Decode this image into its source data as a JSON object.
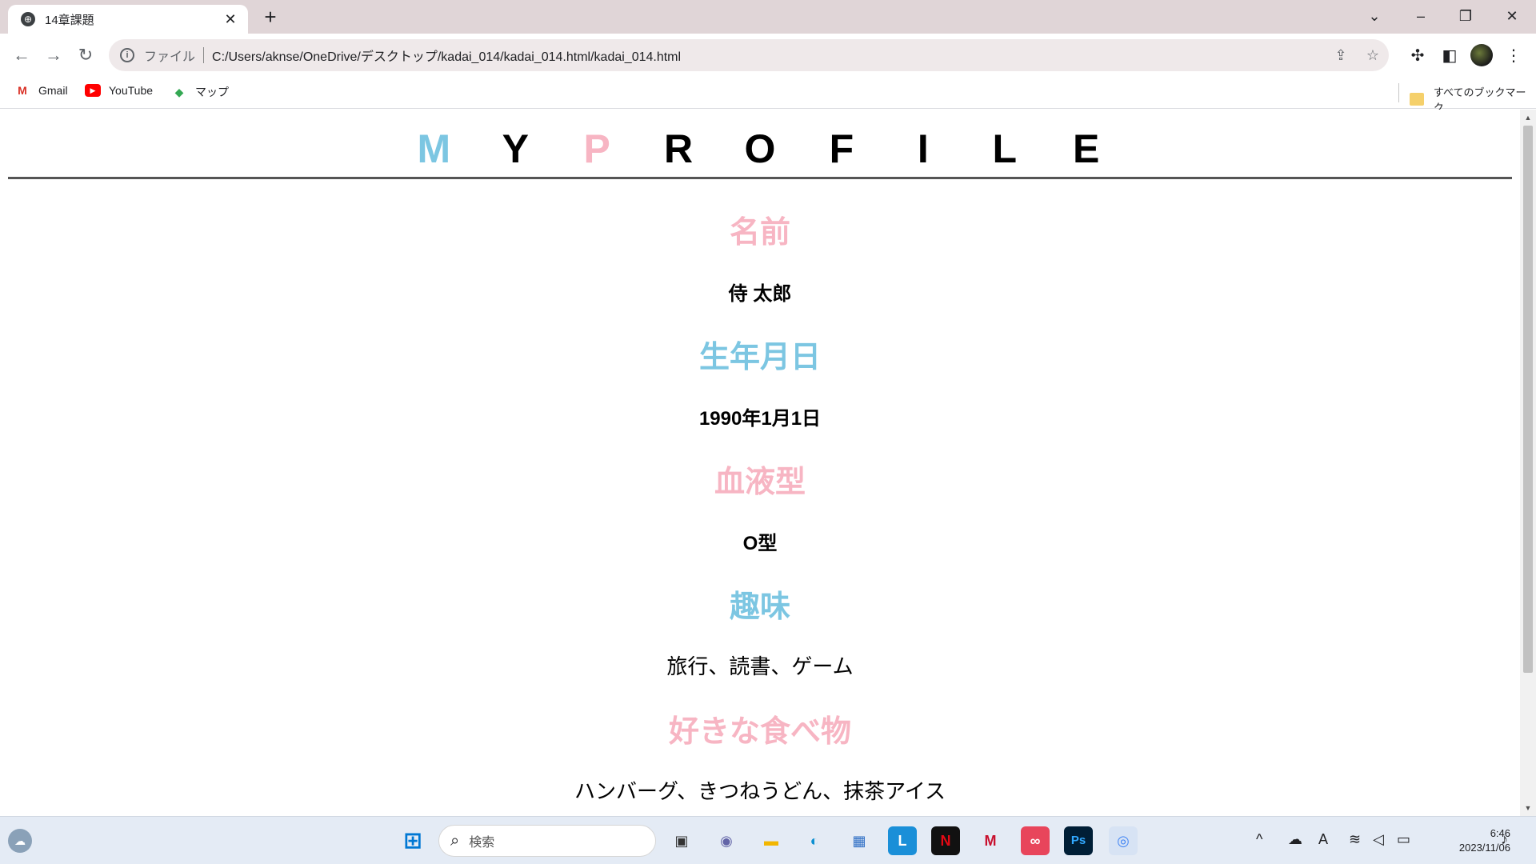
{
  "browser": {
    "tab_title": "14章課題",
    "omnibox_label": "ファイル",
    "url": "C:/Users/aknse/OneDrive/デスクトップ/kadai_014/kadai_014.html/kadai_014.html",
    "bookmarks": [
      {
        "label": "Gmail",
        "icon": "gmail-icon"
      },
      {
        "label": "YouTube",
        "icon": "youtube-icon"
      },
      {
        "label": "マップ",
        "icon": "maps-icon"
      }
    ],
    "all_bookmarks_label": "すべてのブックマーク"
  },
  "page": {
    "title_letters": [
      "M",
      "Y",
      "P",
      "R",
      "O",
      "F",
      "I",
      "L",
      "E"
    ],
    "colors": {
      "pink": "#f7b5c3",
      "blue": "#7cc6e2",
      "black": "#000000"
    },
    "sections": [
      {
        "heading": "名前",
        "value": "侍 太郎"
      },
      {
        "heading": "生年月日",
        "value": "1990年1月1日"
      },
      {
        "heading": "血液型",
        "value": "O型"
      },
      {
        "heading": "趣味",
        "value": "旅行、読書、ゲーム"
      },
      {
        "heading": "好きな食べ物",
        "value": "ハンバーグ、きつねうどん、抹茶アイス"
      }
    ]
  },
  "taskbar": {
    "search_placeholder": "検索",
    "time": "6:46",
    "date": "2023/11/06"
  }
}
